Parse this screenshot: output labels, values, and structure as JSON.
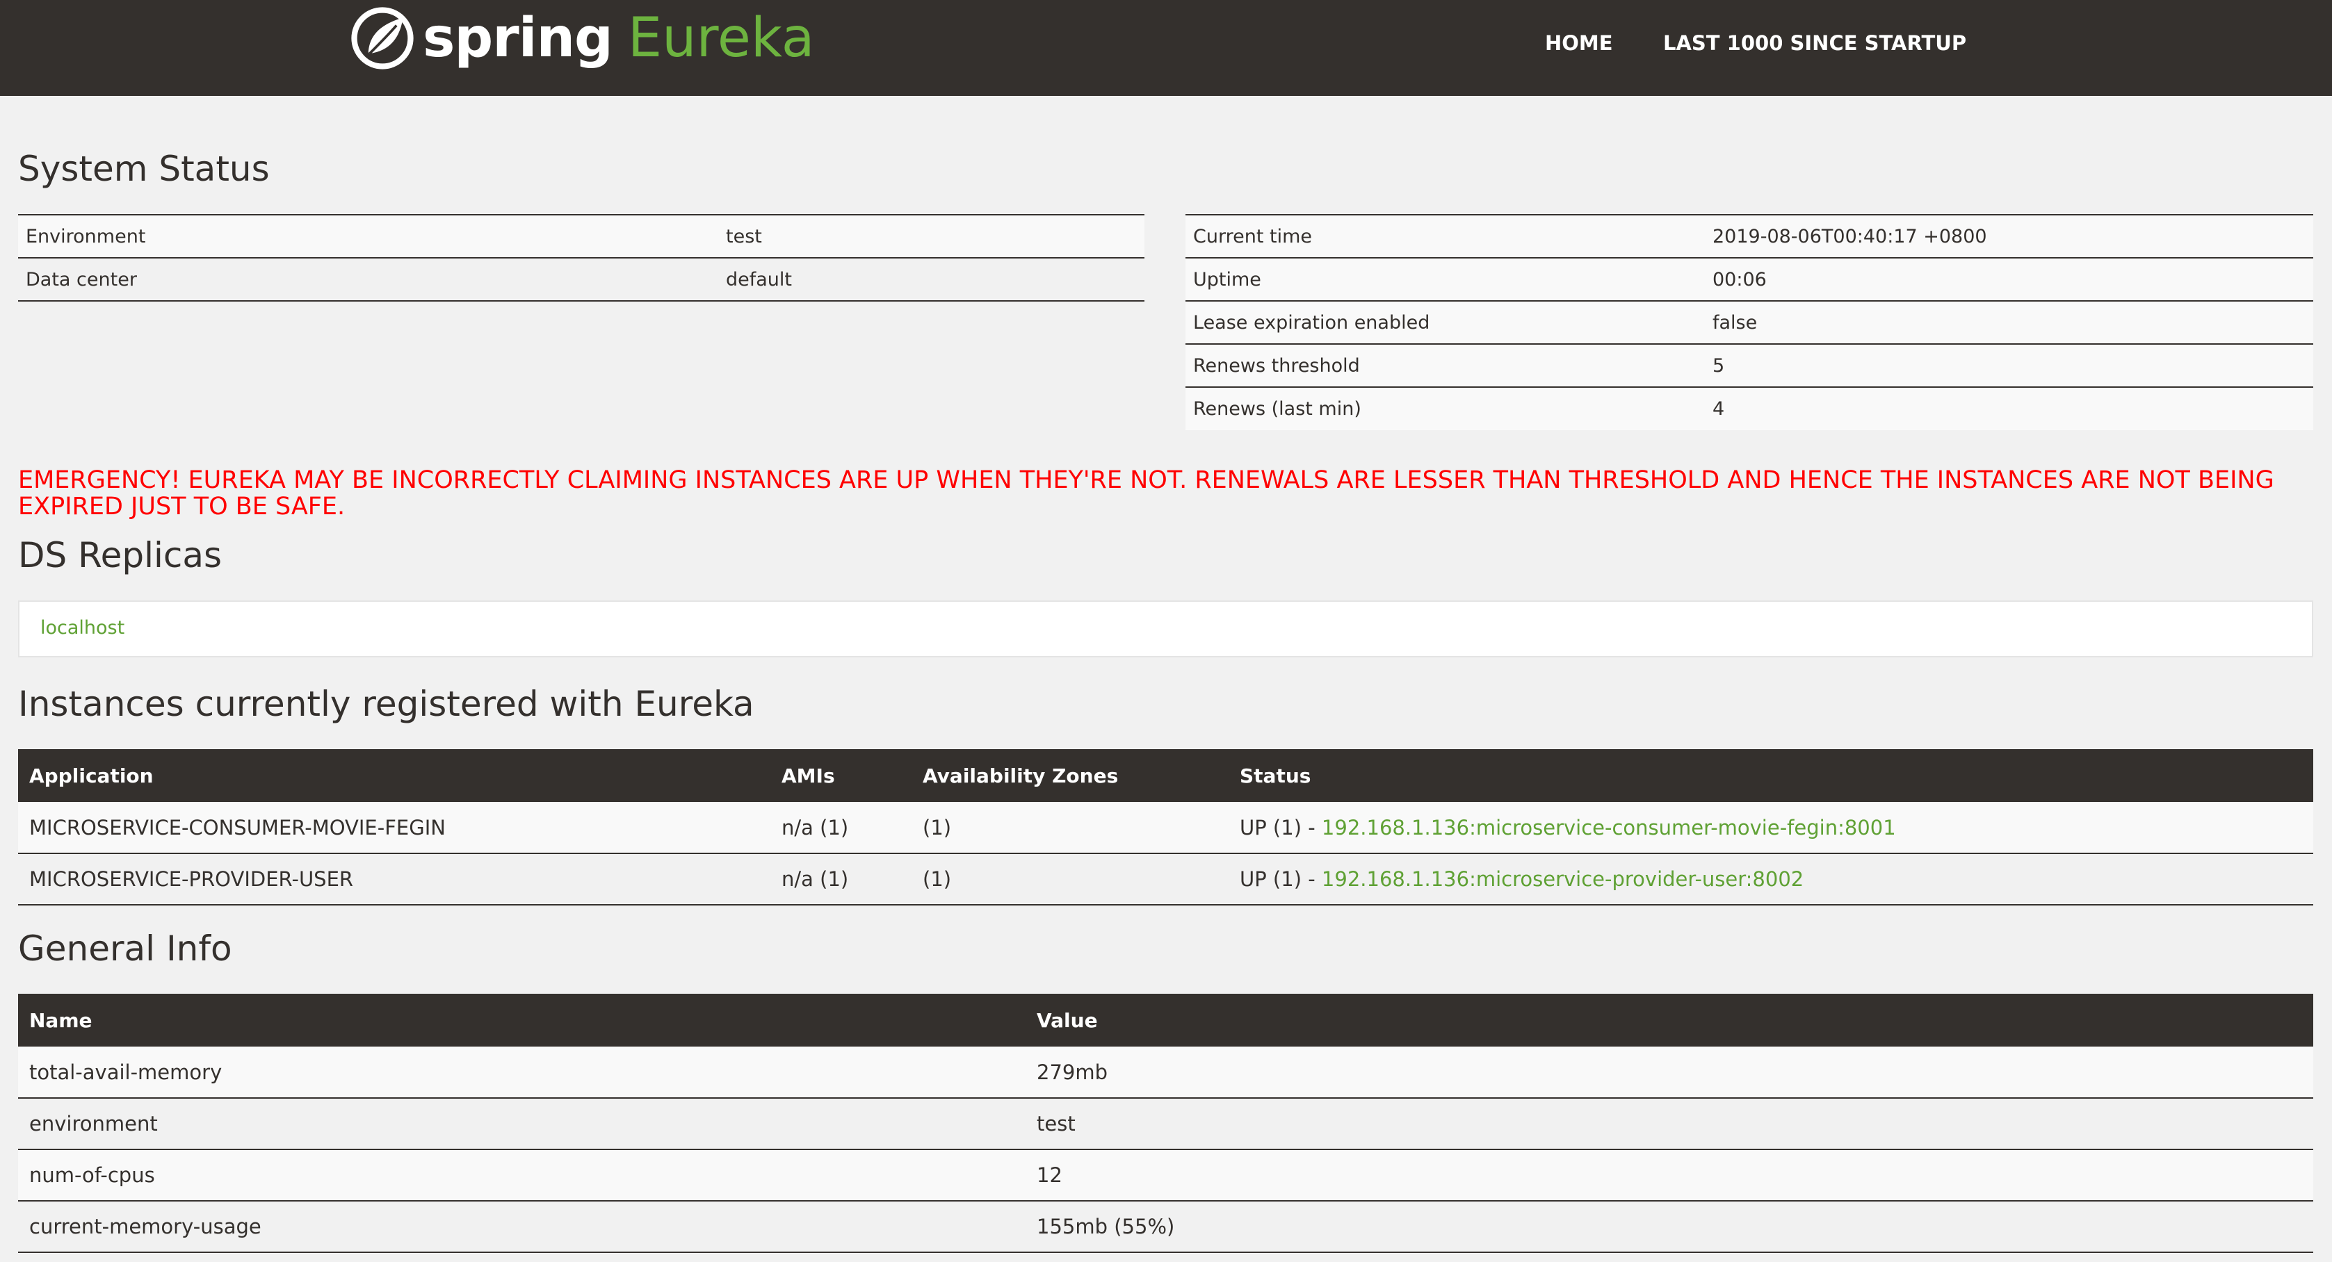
{
  "header": {
    "brand_spring": "spring",
    "brand_eureka": "Eureka",
    "logo_icon": "spring-leaf-icon",
    "nav": [
      {
        "label": "HOME"
      },
      {
        "label": "LAST 1000 SINCE STARTUP"
      }
    ]
  },
  "system_status": {
    "title": "System Status",
    "left": [
      {
        "key": "Environment",
        "value": "test"
      },
      {
        "key": "Data center",
        "value": "default"
      }
    ],
    "right": [
      {
        "key": "Current time",
        "value": "2019-08-06T00:40:17 +0800"
      },
      {
        "key": "Uptime",
        "value": "00:06"
      },
      {
        "key": "Lease expiration enabled",
        "value": "false"
      },
      {
        "key": "Renews threshold",
        "value": "5"
      },
      {
        "key": "Renews (last min)",
        "value": "4"
      }
    ]
  },
  "emergency": "EMERGENCY! EUREKA MAY BE INCORRECTLY CLAIMING INSTANCES ARE UP WHEN THEY'RE NOT. RENEWALS ARE LESSER THAN THRESHOLD AND HENCE THE INSTANCES ARE NOT BEING EXPIRED JUST TO BE SAFE.",
  "replicas": {
    "title": "DS Replicas",
    "items": [
      "localhost"
    ]
  },
  "instances": {
    "title": "Instances currently registered with Eureka",
    "columns": [
      "Application",
      "AMIs",
      "Availability Zones",
      "Status"
    ],
    "rows": [
      {
        "application": "MICROSERVICE-CONSUMER-MOVIE-FEGIN",
        "amis": "n/a (1)",
        "zones": "(1)",
        "status_prefix": "UP (1) - ",
        "status_link": "192.168.1.136:microservice-consumer-movie-fegin:8001"
      },
      {
        "application": "MICROSERVICE-PROVIDER-USER",
        "amis": "n/a (1)",
        "zones": "(1)",
        "status_prefix": "UP (1) - ",
        "status_link": "192.168.1.136:microservice-provider-user:8002"
      }
    ]
  },
  "general_info": {
    "title": "General Info",
    "columns": [
      "Name",
      "Value"
    ],
    "rows": [
      {
        "name": "total-avail-memory",
        "value": "279mb"
      },
      {
        "name": "environment",
        "value": "test"
      },
      {
        "name": "num-of-cpus",
        "value": "12"
      },
      {
        "name": "current-memory-usage",
        "value": "155mb (55%)"
      }
    ]
  },
  "colors": {
    "nav_bg": "#34302d",
    "spring_green": "#6db33f",
    "link_green": "#5fa134",
    "emergency_red": "#ff0000"
  }
}
